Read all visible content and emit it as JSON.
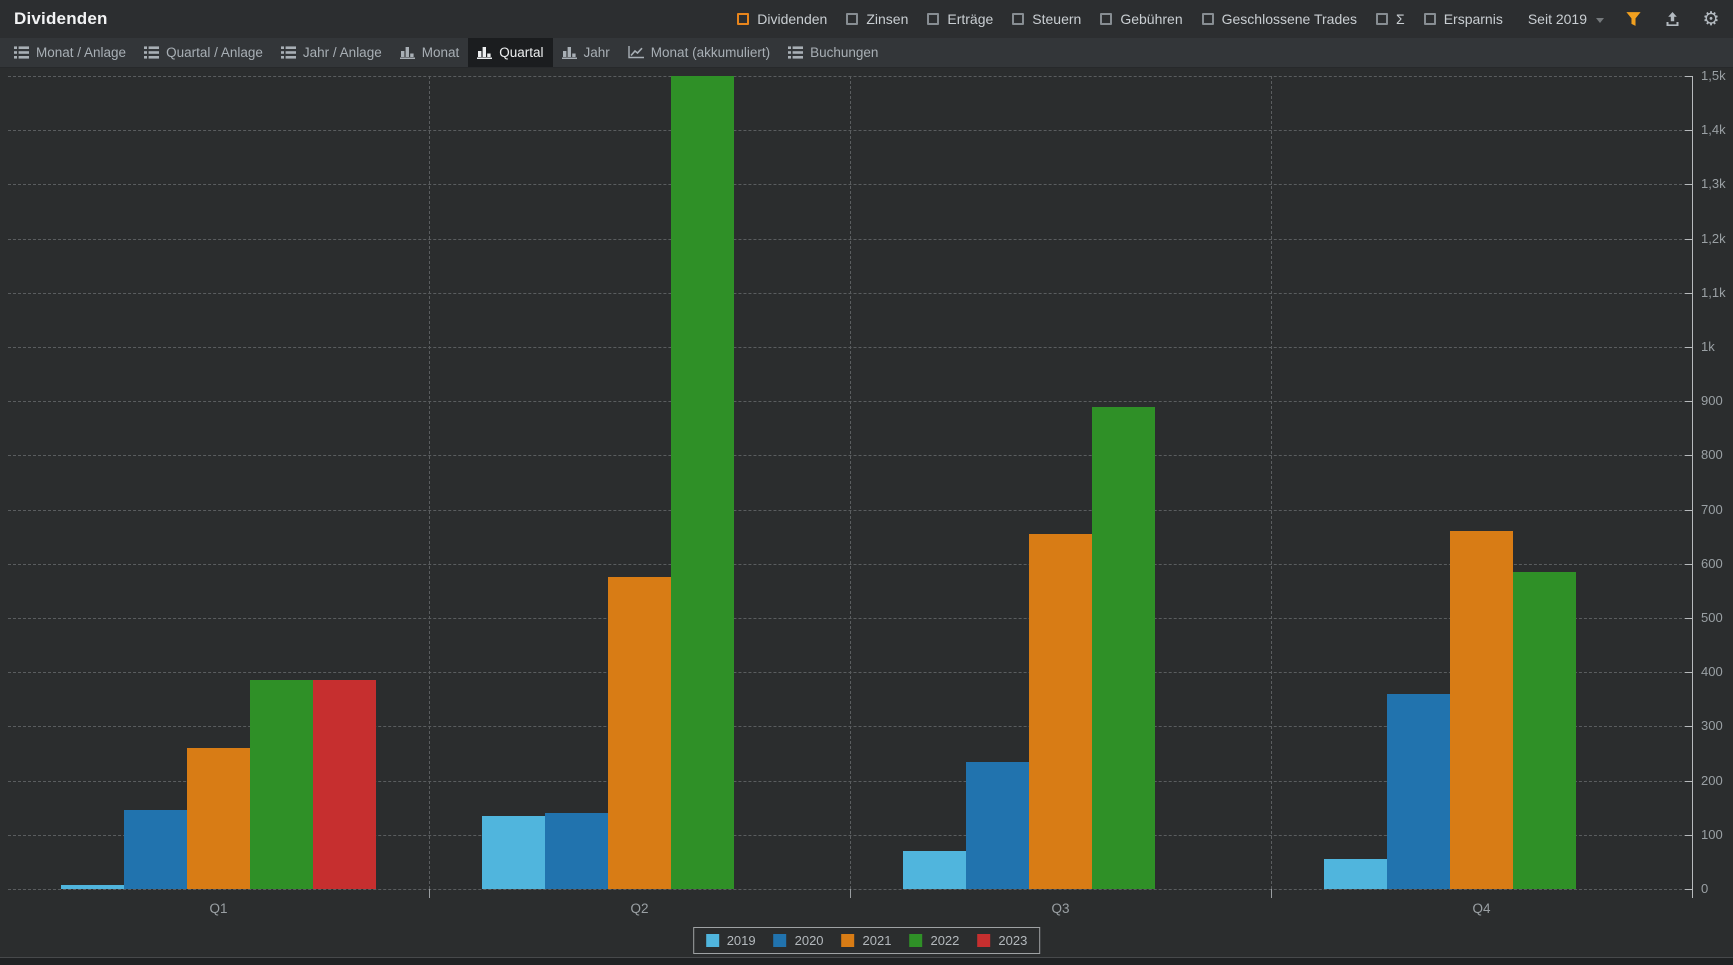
{
  "header": {
    "title": "Dividenden",
    "metrics": [
      {
        "label": "Dividenden",
        "accent": true
      },
      {
        "label": "Zinsen",
        "accent": false
      },
      {
        "label": "Erträge",
        "accent": false
      },
      {
        "label": "Steuern",
        "accent": false
      },
      {
        "label": "Gebühren",
        "accent": false
      },
      {
        "label": "Geschlossene Trades",
        "accent": false
      },
      {
        "label": "Σ",
        "accent": false
      },
      {
        "label": "Ersparnis",
        "accent": false
      }
    ],
    "accent_color": "#e8851c",
    "period_label": "Seit 2019",
    "icons": [
      "filter-icon",
      "export-icon",
      "settings-icon"
    ]
  },
  "toolbar": {
    "items": [
      {
        "label": "Monat / Anlage",
        "icon": "list-icon",
        "selected": false
      },
      {
        "label": "Quartal / Anlage",
        "icon": "list-icon",
        "selected": false
      },
      {
        "label": "Jahr / Anlage",
        "icon": "list-icon",
        "selected": false
      },
      {
        "label": "Monat",
        "icon": "bar-chart-icon",
        "selected": false
      },
      {
        "label": "Quartal",
        "icon": "bar-chart-icon",
        "selected": true
      },
      {
        "label": "Jahr",
        "icon": "bar-chart-icon",
        "selected": false
      },
      {
        "label": "Monat (akkumuliert)",
        "icon": "line-chart-icon",
        "selected": false
      },
      {
        "label": "Buchungen",
        "icon": "list-icon",
        "selected": false
      }
    ]
  },
  "chart_data": {
    "type": "bar",
    "title": "Dividenden",
    "categories": [
      "Q1",
      "Q2",
      "Q3",
      "Q4"
    ],
    "series": [
      {
        "name": "2019",
        "color": "#50b5dd",
        "values": [
          8,
          135,
          70,
          55
        ]
      },
      {
        "name": "2020",
        "color": "#2173ae",
        "values": [
          145,
          140,
          235,
          360
        ]
      },
      {
        "name": "2021",
        "color": "#d87c15",
        "values": [
          260,
          575,
          655,
          660
        ]
      },
      {
        "name": "2022",
        "color": "#2f9027",
        "values": [
          385,
          1500,
          890,
          585
        ]
      },
      {
        "name": "2023",
        "color": "#c62f2f",
        "values": [
          385,
          null,
          null,
          null
        ]
      }
    ],
    "ylim": [
      0,
      1500
    ],
    "ytick_step": 100,
    "ytick_labels": [
      "0",
      "100",
      "200",
      "300",
      "400",
      "500",
      "600",
      "700",
      "800",
      "900",
      "1k",
      "1,1k",
      "1,2k",
      "1,3k",
      "1,4k",
      "1,5k"
    ],
    "grid": true,
    "axis_side": "right",
    "legend_position": "bottom"
  }
}
